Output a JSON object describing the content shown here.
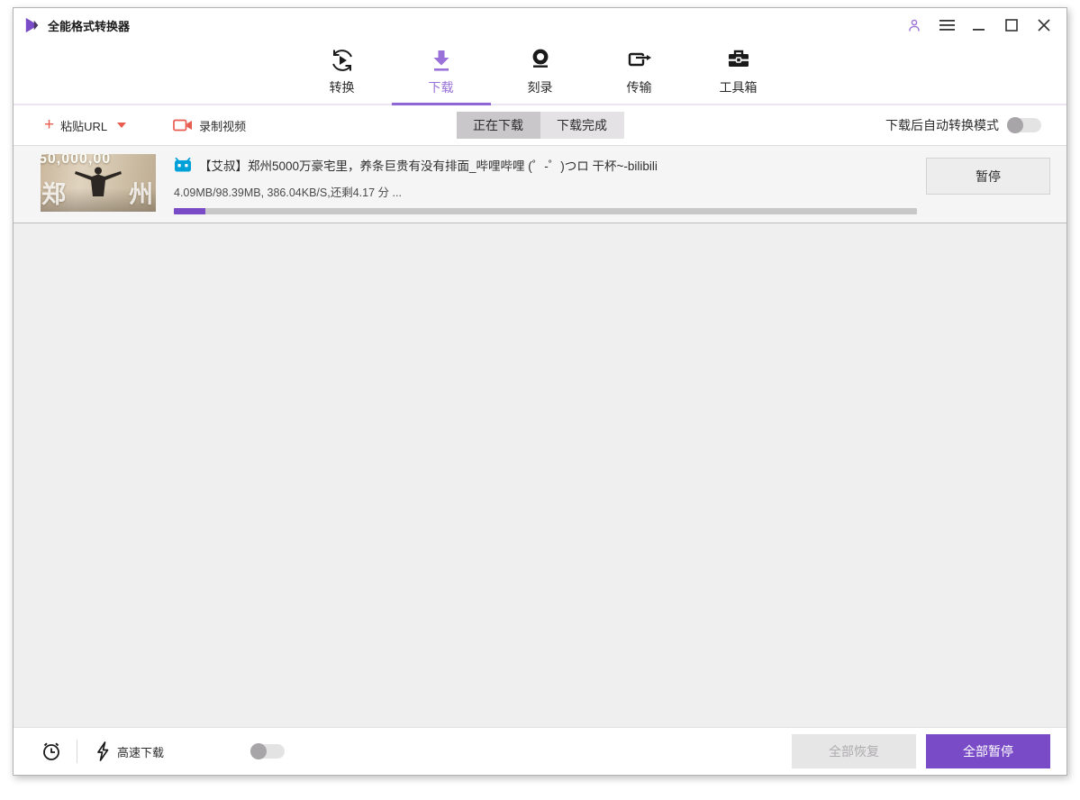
{
  "window": {
    "title": "全能格式转换器"
  },
  "nav": {
    "tabs": [
      {
        "label": "转换",
        "active": false
      },
      {
        "label": "下载",
        "active": true
      },
      {
        "label": "刻录",
        "active": false
      },
      {
        "label": "传输",
        "active": false
      },
      {
        "label": "工具箱",
        "active": false
      }
    ]
  },
  "toolbar": {
    "paste_url_label": "粘贴URL",
    "record_video_label": "录制视频",
    "filter_tabs": [
      {
        "label": "正在下载",
        "active": true
      },
      {
        "label": "下载完成",
        "active": false
      }
    ],
    "auto_convert_label": "下载后自动转换模式",
    "auto_convert_on": false
  },
  "downloads": [
    {
      "title": "【艾叔】郑州5000万豪宅里，养条巨贵有没有排面_哔哩哔哩 (゜-゜)つロ 干杯~-bilibili",
      "progress_text": "4.09MB/98.39MB, 386.04KB/S,还剩4.17 分 ...",
      "progress_percent": 4.2,
      "pause_label": "暂停",
      "thumbnail": {
        "overlay_top": "50,000,00",
        "char_left": "郑",
        "char_right": "州"
      }
    }
  ],
  "footer": {
    "speed_label": "高速下载",
    "speed_on": false,
    "resume_all_label": "全部恢复",
    "pause_all_label": "全部暂停"
  },
  "colors": {
    "accent": "#7a4bc6",
    "accent_light": "#9770d8",
    "danger": "#e85c50",
    "bilibili_blue": "#00a0d8"
  }
}
